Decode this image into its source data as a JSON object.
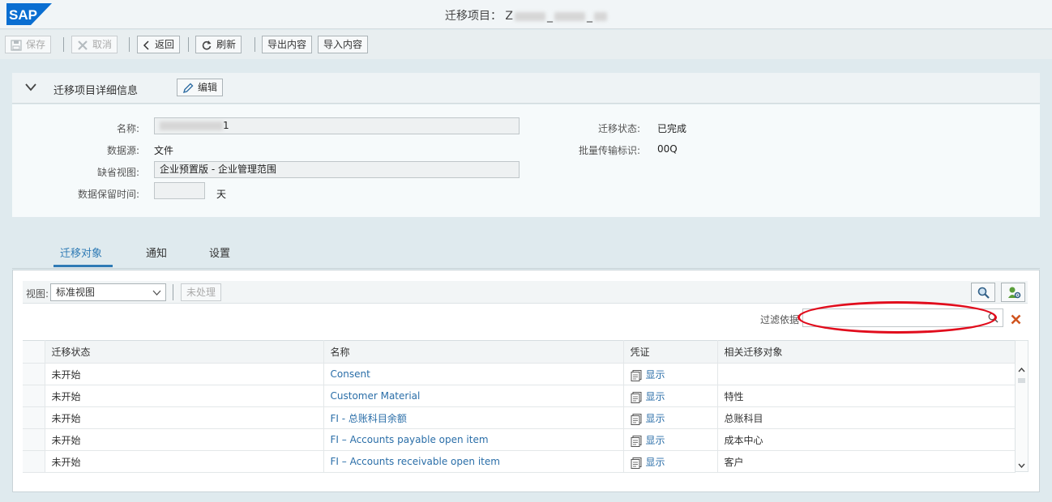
{
  "header": {
    "title_prefix": "迁移项目： Z",
    "title_sep1": "_",
    "title_sep2": "_"
  },
  "toolbar": {
    "save": "保存",
    "cancel": "取消",
    "back": "返回",
    "refresh": "刷新",
    "export": "导出内容",
    "import": "导入内容"
  },
  "details": {
    "section_title": "迁移项目详细信息",
    "edit": "编辑",
    "name_label": "名称:",
    "name_suffix": "1",
    "source_label": "数据源:",
    "source_value": "文件",
    "default_view_label": "缺省视图:",
    "default_view_value": "企业预置版 - 企业管理范围",
    "retention_label": "数据保留时间:",
    "retention_value": "",
    "retention_unit": "天",
    "status_label": "迁移状态:",
    "status_value": "已完成",
    "transport_label": "批量传输标识:",
    "transport_value": "00Q"
  },
  "tabs": [
    "迁移对象",
    "通知",
    "设置"
  ],
  "list": {
    "view_label": "视图:",
    "view_value": "标准视图",
    "unprocessed": "未处理",
    "filter_label": "过滤依据"
  },
  "table": {
    "columns": [
      "迁移状态",
      "名称",
      "凭证",
      "相关迁移对象"
    ],
    "rows": [
      {
        "status": "未开始",
        "name": "Consent",
        "doc": "显示",
        "related": ""
      },
      {
        "status": "未开始",
        "name": "Customer Material",
        "doc": "显示",
        "related": "特性"
      },
      {
        "status": "未开始",
        "name": "FI - 总账科目余额",
        "doc": "显示",
        "related": "总账科目"
      },
      {
        "status": "未开始",
        "name": "FI – Accounts payable open item",
        "doc": "显示",
        "related": "成本中心"
      },
      {
        "status": "未开始",
        "name": "FI – Accounts receivable open item",
        "doc": "显示",
        "related": "客户"
      }
    ]
  },
  "colors": {
    "brand": "#0a6ed1",
    "link": "#2a6ea8",
    "highlight": "#e10c1c",
    "close": "#d0541f"
  }
}
